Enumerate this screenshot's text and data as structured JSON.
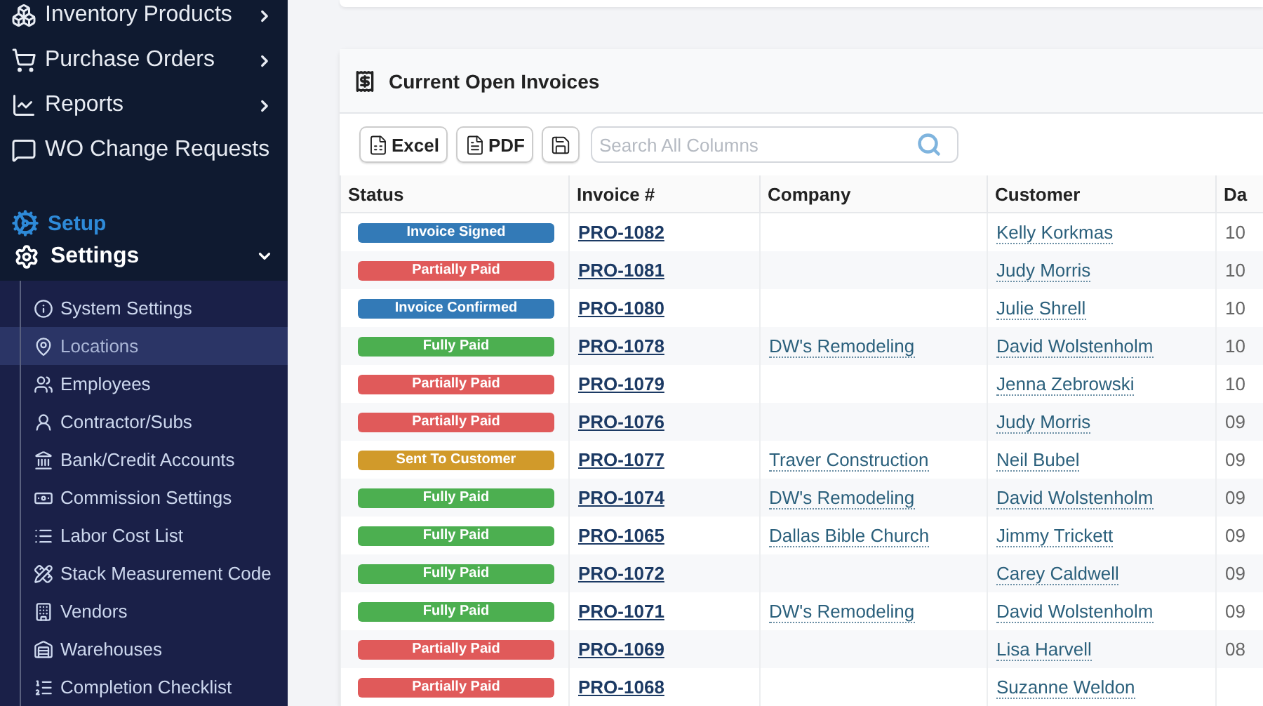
{
  "sidebar": {
    "items": [
      {
        "label": "Inventory Products",
        "expandable": true
      },
      {
        "label": "Purchase Orders",
        "expandable": true
      },
      {
        "label": "Reports",
        "expandable": true
      },
      {
        "label": "WO Change Requests",
        "expandable": false
      }
    ],
    "section_label": "Setup",
    "group": {
      "label": "Settings",
      "expanded": true,
      "children": [
        {
          "label": "System Settings",
          "selected": false
        },
        {
          "label": "Locations",
          "selected": true
        },
        {
          "label": "Employees",
          "selected": false
        },
        {
          "label": "Contractor/Subs",
          "selected": false
        },
        {
          "label": "Bank/Credit Accounts",
          "selected": false
        },
        {
          "label": "Commission Settings",
          "selected": false
        },
        {
          "label": "Labor Cost List",
          "selected": false
        },
        {
          "label": "Stack Measurement Code",
          "selected": false
        },
        {
          "label": "Vendors",
          "selected": false
        },
        {
          "label": "Warehouses",
          "selected": false
        },
        {
          "label": "Completion Checklist",
          "selected": false
        }
      ]
    }
  },
  "invoices": {
    "title": "Current Open Invoices",
    "export_buttons": [
      "Excel",
      "PDF"
    ],
    "search": {
      "placeholder": "Search All Columns"
    },
    "table": {
      "columns": [
        "Status",
        "Invoice #",
        "Company",
        "Customer",
        "Da"
      ],
      "rows": [
        {
          "status": {
            "label": "Invoice Signed",
            "color": "#337ab7"
          },
          "invoice": "PRO-1082",
          "customer": "Kelly Korkmas",
          "date": "10"
        },
        {
          "status": {
            "label": "Partially Paid",
            "color": "#e05a5a"
          },
          "invoice": "PRO-1081",
          "customer": "Judy Morris",
          "date": "10"
        },
        {
          "status": {
            "label": "Invoice Confirmed",
            "color": "#337ab7"
          },
          "invoice": "PRO-1080",
          "customer": "Julie Shrell",
          "date": "10"
        },
        {
          "status": {
            "label": "Fully Paid",
            "color": "#4caf50"
          },
          "invoice": "PRO-1078",
          "company": "DW's Remodeling",
          "customer": "David Wolstenholm",
          "date": "10"
        },
        {
          "status": {
            "label": "Partially Paid",
            "color": "#e05a5a"
          },
          "invoice": "PRO-1079",
          "customer": "Jenna Zebrowski",
          "date": "10"
        },
        {
          "status": {
            "label": "Partially Paid",
            "color": "#e05a5a"
          },
          "invoice": "PRO-1076",
          "customer": "Judy Morris",
          "date": "09"
        },
        {
          "status": {
            "label": "Sent To Customer",
            "color": "#d19a2a"
          },
          "invoice": "PRO-1077",
          "company": "Traver Construction",
          "customer": "Neil Bubel",
          "date": "09"
        },
        {
          "status": {
            "label": "Fully Paid",
            "color": "#4caf50"
          },
          "invoice": "PRO-1074",
          "company": "DW's Remodeling",
          "customer": "David Wolstenholm",
          "date": "09"
        },
        {
          "status": {
            "label": "Fully Paid",
            "color": "#4caf50"
          },
          "invoice": "PRO-1065",
          "company": "Dallas Bible Church",
          "customer": "Jimmy Trickett",
          "date": "09"
        },
        {
          "status": {
            "label": "Fully Paid",
            "color": "#4caf50"
          },
          "invoice": "PRO-1072",
          "customer": "Carey Caldwell",
          "date": "09"
        },
        {
          "status": {
            "label": "Fully Paid",
            "color": "#4caf50"
          },
          "invoice": "PRO-1071",
          "company": "DW's Remodeling",
          "customer": "David Wolstenholm",
          "date": "09"
        },
        {
          "status": {
            "label": "Partially Paid",
            "color": "#e05a5a"
          },
          "invoice": "PRO-1069",
          "customer": "Lisa Harvell",
          "date": "08"
        },
        {
          "status": {
            "label": "Partially Paid",
            "color": "#e05a5a"
          },
          "invoice": "PRO-1068",
          "customer": "Suzanne Weldon"
        }
      ]
    }
  }
}
